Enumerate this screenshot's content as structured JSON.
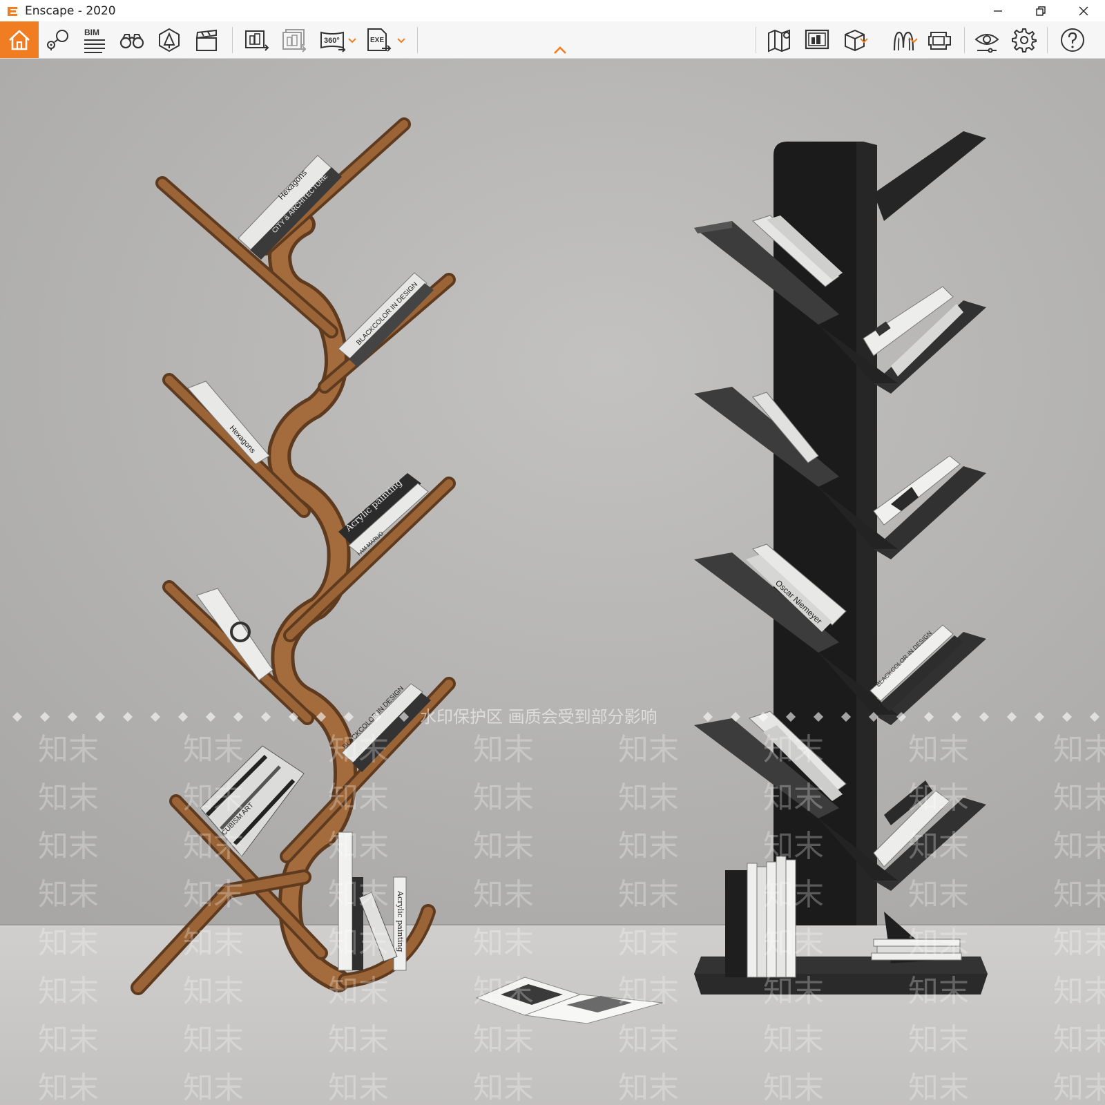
{
  "window": {
    "title": "Enscape - 2020",
    "controls": [
      "minimize-icon",
      "restore-icon",
      "close-icon"
    ]
  },
  "toolbar": {
    "accent_color": "#f07d22",
    "bim_label": "BIM",
    "left_tools": [
      "home-icon",
      "view-management-icon",
      "bim-icon",
      "binoculars-icon",
      "asset-library-icon",
      "video-editor-icon",
      "screenshot-icon",
      "batch-render-icon",
      "panorama-360-icon",
      "exe-export-icon"
    ],
    "right_tools": [
      "map-icon",
      "screen-share-icon",
      "cube-icon",
      "atlas-icon",
      "vr-headset-icon",
      "visual-settings-icon",
      "settings-icon",
      "help-icon"
    ],
    "panorama_label": "360°",
    "exe_label": "EXE"
  },
  "scene": {
    "description_colors": {
      "wall": "#b9b8b6",
      "floor": "#c6c5c3",
      "wood": "#8a5a32",
      "black_shelf": "#1e1e1e"
    },
    "watermark_notice": "水印保护区   画质会受到部分影响",
    "watermark_text": "知末",
    "book_spines": {
      "hexagons": "Hexagons",
      "city_arch": "CITY & ARCHITECTURE",
      "blackcolor": "BLACKCOLOR IN DESIGN",
      "acrylic": "Acrylic painting",
      "cubism": "CUBISM ART",
      "neimeyer": "Oscar Niemeyer",
      "maruo": "I AM MARUO"
    }
  }
}
